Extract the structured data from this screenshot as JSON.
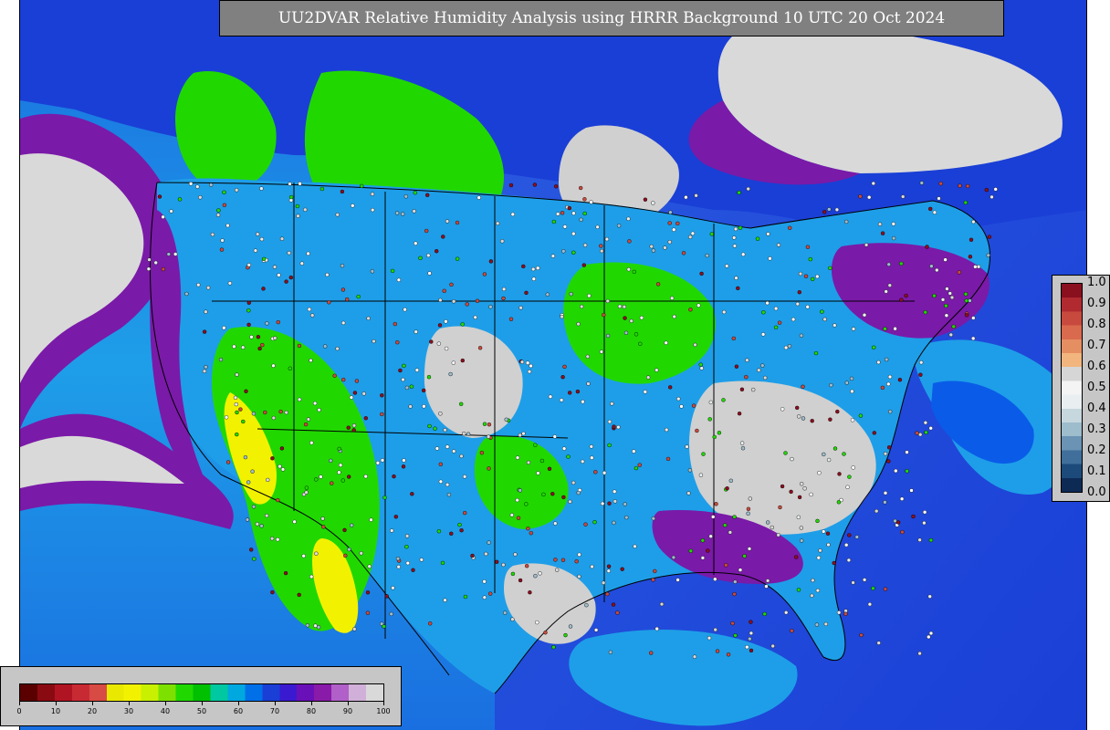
{
  "title": "UU2DVAR Relative Humidity Analysis using HRRR Background 10 UTC 20 Oct 2024",
  "obs_legend": {
    "ticks": [
      "1.0",
      "0.9",
      "0.8",
      "0.7",
      "0.6",
      "0.5",
      "0.4",
      "0.3",
      "0.2",
      "0.1",
      "0.0"
    ],
    "colors": [
      "#0d2a55",
      "#1c4a7a",
      "#3f6f9a",
      "#6a93b4",
      "#9dbccc",
      "#c6d7de",
      "#e9eef0",
      "#f4f4f4",
      "#d6d6d6",
      "#f1b57d",
      "#e58e62",
      "#d96a4e",
      "#c84a3e",
      "#b12a30",
      "#8a0f1f"
    ]
  },
  "rh_legend": {
    "ticks": [
      "0",
      "10",
      "20",
      "30",
      "40",
      "50",
      "60",
      "70",
      "80",
      "90",
      "100"
    ],
    "colors": [
      "#5a0000",
      "#8a0a12",
      "#b01422",
      "#c82a34",
      "#d84a44",
      "#e8e800",
      "#f2f200",
      "#c8f000",
      "#7ee000",
      "#20d800",
      "#00c000",
      "#00c8a0",
      "#00a8e0",
      "#0070e8",
      "#1a3fd6",
      "#3a1ad0",
      "#6a10b8",
      "#8a1aa8",
      "#b060c8",
      "#d0b0d8",
      "#d9d9d9"
    ]
  },
  "map": {
    "ocean_colors": [
      "#1a3fd6",
      "#0a5ce8",
      "#1e9ee8",
      "#7a1aa8",
      "#d9d9d9"
    ],
    "land_colors": [
      "#20d800",
      "#1e9ee8",
      "#1a3fd6",
      "#d0d0d0",
      "#7a1aa8",
      "#f2f200"
    ]
  }
}
